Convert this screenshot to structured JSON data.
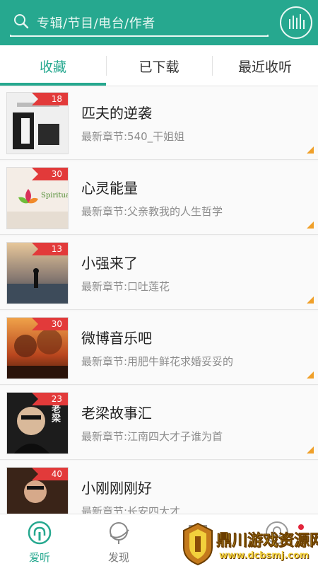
{
  "header": {
    "search_placeholder": "专辑/节目/电台/作者",
    "accent": "#26a88f"
  },
  "tabs": [
    {
      "label": "收藏",
      "active": true
    },
    {
      "label": "已下载",
      "active": false
    },
    {
      "label": "最近收听",
      "active": false
    }
  ],
  "items": [
    {
      "title": "匹夫的逆袭",
      "subtitle": "最新章节:540_干姐姐",
      "badge": "18"
    },
    {
      "title": "心灵能量",
      "subtitle": "最新章节:父亲教我的人生哲学",
      "badge": "30",
      "cover_text": "Spiritual"
    },
    {
      "title": "小强来了",
      "subtitle": "最新章节:口吐莲花",
      "badge": "13"
    },
    {
      "title": "微博音乐吧",
      "subtitle": "最新章节:用肥牛鲜花求婚妥妥的",
      "badge": "30"
    },
    {
      "title": "老梁故事汇",
      "subtitle": "最新章节:江南四大才子谁为首",
      "badge": "23",
      "cover_text": "老梁"
    },
    {
      "title": "小刚刚刚好",
      "subtitle": "最新章节:长安四大才",
      "badge": "40"
    }
  ],
  "bottom_nav": [
    {
      "label": "爱听",
      "icon": "headphones-icon",
      "active": true
    },
    {
      "label": "发现",
      "icon": "planet-icon",
      "active": false
    },
    {
      "label": "",
      "icon": "store-icon",
      "active": false
    },
    {
      "label": "",
      "icon": "profile-icon",
      "active": false
    }
  ],
  "watermark": {
    "line1": "鼎川游戏资源网",
    "line2": "www.dcbsmj.com"
  }
}
